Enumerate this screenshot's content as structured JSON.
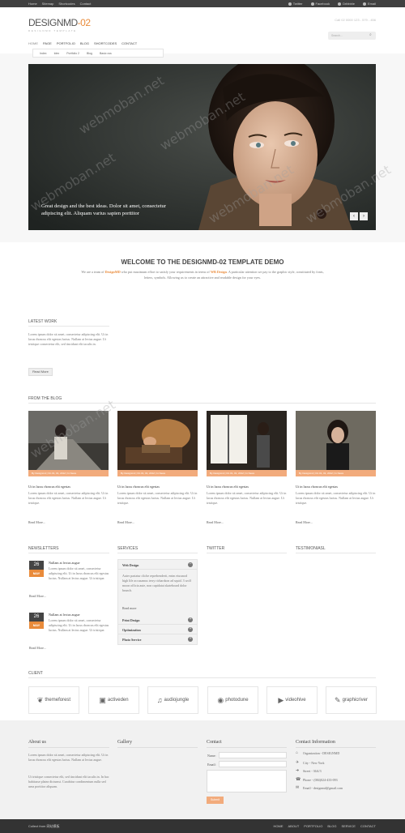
{
  "topbar": {
    "links": [
      "Home",
      "Sitemap",
      "Shortcodes",
      "Contact"
    ],
    "social": [
      "Twitter",
      "Facebook",
      "Dribbble",
      "Email"
    ]
  },
  "header": {
    "logo_main": "DESIGNMD",
    "logo_accent": "-02",
    "tagline": "DESIGNMD TEMPLATE",
    "phone": "Call 02 0000 123 - 579 - 456",
    "search_placeholder": "Search..."
  },
  "nav": {
    "items": [
      "HOME",
      "PAGE",
      "PORTFOLIO",
      "BLOG",
      "SHORTCODES",
      "CONTACT"
    ],
    "sub_items": [
      "Index",
      "Idex",
      "Portfolio 2",
      "Blog",
      "Basic css"
    ]
  },
  "slider": {
    "caption_line1": "Great design and the best ideas. Dolor sit amet, consectetur",
    "caption_line2": "adipiscing elit. Aliquam varius sapien porttitor",
    "prev": "‹",
    "next": "›"
  },
  "welcome": {
    "title": "WELCOME TO THE DESIGNMD-02 TEMPLATE DEMO",
    "intro_a": "We are a team of ",
    "intro_brand": "DesignMD",
    "intro_b": " who put maximum effort to satisfy your requirements in terms of ",
    "intro_wd": "WB Design",
    "intro_c": ". A particular attention we pay to the graphic style, constituted by fonts, letters, symbols. Allowing us to create an attractive and readable design for your eyes."
  },
  "latest_work": {
    "title": "LATEST WORK",
    "text": "Lorem ipsum dolor sit amet, consectetur adipiscing elit. Ut in lacus rhoncus elit egestas luctus. Nullam at lectus augue. Ut tristique consectetur elit, sed tincidunt elit iaculis in.",
    "button": "Read More"
  },
  "blog": {
    "title": "FROM THE BLOG",
    "posts": [
      {
        "meta": "By Designmd | On 01, 01, 2012 | In News",
        "title": "Ut in lacus rhoncus elit egestas",
        "text": "Lorem ipsum dolor sit amet, consectetur adipiscing elit. Ut in lacus rhoncus elit egestas luctus. Nullam at lectus augue. Ut tristique.",
        "more": "Read More..."
      },
      {
        "meta": "By Designmd | On 01, 01, 2012 | In News",
        "title": "Ut in lacus rhoncus elit egestas",
        "text": "Lorem ipsum dolor sit amet, consectetur adipiscing elit. Ut in lacus rhoncus elit egestas luctus. Nullam at lectus augue. Ut tristique.",
        "more": "Read More..."
      },
      {
        "meta": "By Designmd | On 01, 01, 2012 | In News",
        "title": "Ut in lacus rhoncus elit egestas",
        "text": "Lorem ipsum dolor sit amet, consectetur adipiscing elit. Ut in lacus rhoncus elit egestas luctus. Nullam at lectus augue. Ut tristique.",
        "more": "Read More..."
      },
      {
        "meta": "By Designmd | On 01, 01, 2012 | In News",
        "title": "Ut in lacus rhoncus elit egestas",
        "text": "Lorem ipsum dolor sit amet, consectetur adipiscing elit. Ut in lacus rhoncus elit egestas luctus. Nullam at lectus augue. Ut tristique.",
        "more": "Read More..."
      }
    ]
  },
  "newsletters": {
    "title": "NEWSLETTERS",
    "items": [
      {
        "day": "26",
        "month": "MAY",
        "title": "Nullam at lectus augue",
        "text": "Lorem ipsum dolor sit amet, consectetur adipiscing elit. Ut in lacus rhoncus elit egestas luctus. Nullam at lectus augue. Ut tristique.",
        "more": "Read More..."
      },
      {
        "day": "26",
        "month": "MAY",
        "title": "Nullam at lectus augue",
        "text": "Lorem ipsum dolor sit amet, consectetur adipiscing elit. Ut in lacus rhoncus elit egestas luctus. Nullam at lectus augue. Ut tristique.",
        "more": "Read More..."
      }
    ]
  },
  "services": {
    "title": "SERVICES",
    "open_title": "Web Design",
    "open_text": "Auter pariatur cliche reprehenderit, enim eiusmod high life accusamus terry richardson ad squid. 3 wolf moon officia aute, non cupidatat skateboard dolor brunch.",
    "open_more": "Read more",
    "rows": [
      "Print Design",
      "Optimization",
      "Photo Service"
    ],
    "toggle_open": "−",
    "toggle_closed": "+"
  },
  "twitter": {
    "title": "TWITTER"
  },
  "testimonial": {
    "title": "TESTIMONIASL"
  },
  "clients": {
    "title": "CLIENT",
    "items": [
      "themeforest",
      "activeden",
      "audiojungle",
      "photodune",
      "videohive",
      "graphicriver"
    ]
  },
  "footer": {
    "about_title": "About us",
    "about_text1": "Lorem ipsum dolor sit amet, consectetur adipiscing elit. Ut in lacus rhoncus elit egestas luctus. Nullam at lectus augue.",
    "about_text2": "Ut tristique consectetur elit, sed tincidunt elit iaculis in. In hac habitasse platea dictumst. Curabitur condimentum nulla sed urna porttitor aliquam.",
    "gallery_title": "Gallery",
    "contact_title": "Contact",
    "name_label": "Name:",
    "email_label": "Email:",
    "send": "Submit",
    "info_title": "Contact Information",
    "info": [
      {
        "icon": "⌂",
        "text": "Organization - DESIGNMD"
      },
      {
        "icon": "✈",
        "text": "City - New York"
      },
      {
        "icon": "➜",
        "text": "Street - 36A/3"
      },
      {
        "icon": "☎",
        "text": "Phone - (084)024-433-093"
      },
      {
        "icon": "✉",
        "text": "Email - designmd@gmail.com"
      }
    ],
    "copyright": "Collect from 网站模板",
    "links": [
      "HOME",
      "ABOUT",
      "PORTFOLIO",
      "BLOG",
      "SERVICE",
      "CONTACT"
    ]
  },
  "watermark": "webmoban.net",
  "colors": {
    "accent": "#e98b3b",
    "meta_bar": "#f2ab7c",
    "topbar": "#404040",
    "copybar": "#333333"
  }
}
